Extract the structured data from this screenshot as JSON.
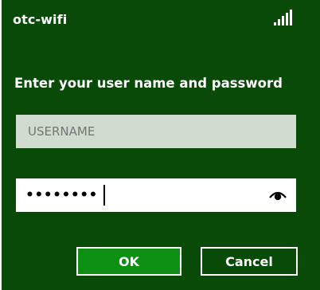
{
  "network": {
    "name": "otc-wifi",
    "signal_icon": "signal-bars-icon"
  },
  "dialog": {
    "prompt": "Enter your user name and password",
    "username_placeholder": "USERNAME",
    "username_value": "",
    "password_mask": "••••••••",
    "reveal_icon": "eye-icon"
  },
  "buttons": {
    "ok_label": "OK",
    "cancel_label": "Cancel"
  },
  "colors": {
    "background": "#0a4a09",
    "ok_button": "#0c8f13",
    "username_field": "#d0dcd0"
  }
}
